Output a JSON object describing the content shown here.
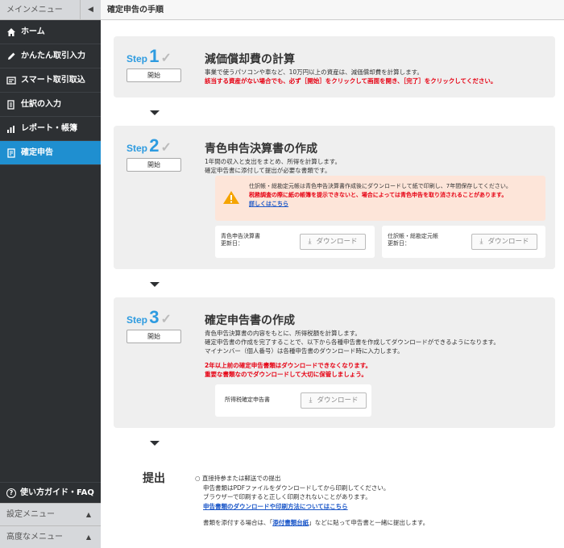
{
  "sidebar": {
    "header": "メインメニュー",
    "collapse_glyph": "◀",
    "items": [
      {
        "label": "ホーム",
        "icon": "home-icon"
      },
      {
        "label": "かんたん取引入力",
        "icon": "pencil-icon"
      },
      {
        "label": "スマート取引取込",
        "icon": "import-icon"
      },
      {
        "label": "仕訳の入力",
        "icon": "journal-icon"
      },
      {
        "label": "レポート・帳簿",
        "icon": "report-icon"
      },
      {
        "label": "確定申告",
        "icon": "tax-return-icon"
      }
    ],
    "guide": {
      "label": "使い方ガイド・FAQ",
      "icon_glyph": "?"
    },
    "settings_menu": "設定メニュー",
    "advanced_menu": "高度なメニュー",
    "submenu_arrow": "▲"
  },
  "page_title": "確定申告の手順",
  "steps": [
    {
      "step_word": "Step",
      "number": "1",
      "check": "✓",
      "start_label": "開始",
      "title": "減価償却費の計算",
      "lines": [
        "事業で使うパソコンや車など、10万円以上の資産は、減価償却費を計算します。"
      ],
      "red_lines": [
        "該当する資産がない場合でも、必ず［開始］をクリックして画面を開き、［完了］をクリックしてください。"
      ]
    },
    {
      "step_word": "Step",
      "number": "2",
      "check": "✓",
      "start_label": "開始",
      "title": "青色申告決算書の作成",
      "lines": [
        "1年間の収入と支出をまとめ、所得を計算します。",
        "確定申告書に添付して提出が必要な書類です。"
      ],
      "warning": {
        "line1": "仕訳帳・総勘定元帳は青色申告決算書作成後にダウンロードして紙で印刷し、7年間保存してください。",
        "line2": "税務調査の際に紙の帳簿を提示できないと、場合によっては青色申告を取り消されることがあります。",
        "link": "詳しくはこちら"
      },
      "downloads": [
        {
          "title": "青色申告決算書",
          "updated": "更新日：",
          "button": "ダウンロード"
        },
        {
          "title": "仕訳帳・総勘定元帳",
          "updated": "更新日：",
          "button": "ダウンロード"
        }
      ]
    },
    {
      "step_word": "Step",
      "number": "3",
      "check": "✓",
      "start_label": "開始",
      "title": "確定申告書の作成",
      "lines": [
        "青色申告決算書の内容をもとに、所得税額を計算します。",
        "確定申告書の作成を完了することで、以下から各種申告書を作成してダウンロードができるようになります。",
        "マイナンバー（個人番号）は各種申告書のダウンロード時に入力します。"
      ],
      "red_lines": [
        "2年以上前の確定申告書類はダウンロードできなくなります。",
        "重要な書類なのでダウンロードして大切に保管しましょう。"
      ],
      "downloads": [
        {
          "title": "所得税確定申告書",
          "button": "ダウンロード"
        }
      ]
    }
  ],
  "download_icon_glyph": "⤓",
  "submit": {
    "title": "提出",
    "option": "○ 直接持参または郵送での提出",
    "line1": "申告書類はPDFファイルをダウンロードしてから印刷してください。",
    "line2": "ブラウザーで印刷すると正しく印刷されないことがあります。",
    "link1": "申告書類のダウンロードや印刷方法についてはこちら",
    "line3_prefix": "書類を添付する場合は、「",
    "link2": "添付書類台紙",
    "line3_suffix": "」などに貼って申告書と一緒に提出します。"
  }
}
